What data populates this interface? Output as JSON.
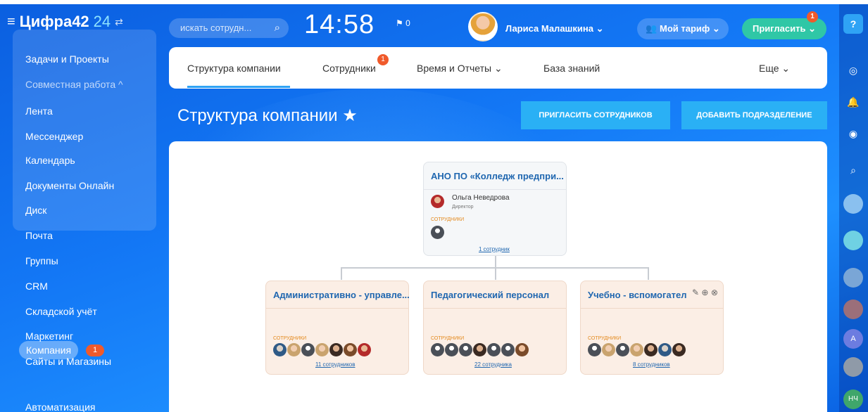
{
  "header": {
    "logo_brand": "Цифра42",
    "logo_num": "24",
    "search_placeholder": "искать сотрудн...",
    "clock": "14:58",
    "flag_count": "0",
    "user_name": "Лариса Малашкина ⌄",
    "tariff_label": "Мой тариф ⌄",
    "invite_label": "Пригласить ⌄",
    "invite_badge": "1"
  },
  "sidebar": {
    "items": [
      {
        "label": "Задачи и Проекты"
      },
      {
        "label": "Совместная работа ^"
      },
      {
        "label": "Лента"
      },
      {
        "label": "Мессенджер"
      },
      {
        "label": "Календарь"
      },
      {
        "label": "Документы Онлайн"
      },
      {
        "label": "Диск"
      },
      {
        "label": "Почта"
      },
      {
        "label": "Группы"
      },
      {
        "label": "CRM"
      },
      {
        "label": "Складской учёт"
      },
      {
        "label": "Маркетинг"
      },
      {
        "label": "Сайты и Магазины"
      },
      {
        "label": "Компания"
      },
      {
        "label": "Автоматизация"
      }
    ],
    "company_badge": "1"
  },
  "tabs": [
    {
      "label": "Структура компании"
    },
    {
      "label": "Сотрудники"
    },
    {
      "label": "Время и Отчеты ⌄"
    },
    {
      "label": "База знаний"
    },
    {
      "label": "Еще ⌄"
    }
  ],
  "tab_badge": "1",
  "page": {
    "title": "Структура компании ★",
    "invite_employees_button": "ПРИГЛАСИТЬ СОТРУДНИКОВ",
    "add_department_button": "ДОБАВИТЬ ПОДРАЗДЕЛЕНИЕ"
  },
  "org": {
    "root": {
      "title": "АНО ПО «Колледж предпри...",
      "head_name": "Ольга Неведрова",
      "head_role": "Директор",
      "employees_label": "СОТРУДНИКИ",
      "count_link": "1 сотрудник"
    },
    "departments": [
      {
        "title": "Административно - управле...",
        "employees_label": "СОТРУДНИКИ",
        "count_link": "11 сотрудников"
      },
      {
        "title": "Педагогический персонал",
        "employees_label": "СОТРУДНИКИ",
        "count_link": "22 сотрудника"
      },
      {
        "title": "Учебно - вспомогательный",
        "employees_label": "СОТРУДНИКИ",
        "count_link": "8 сотрудников"
      }
    ]
  },
  "rail": {
    "help": "?",
    "avatar_initials_a": "A",
    "avatar_initials_nch": "НЧ"
  },
  "colors": {
    "accent": "#2ab0f5",
    "invite_green": "#2fc7a6",
    "badge_orange": "#f05a2b",
    "link_blue": "#2067b0"
  }
}
